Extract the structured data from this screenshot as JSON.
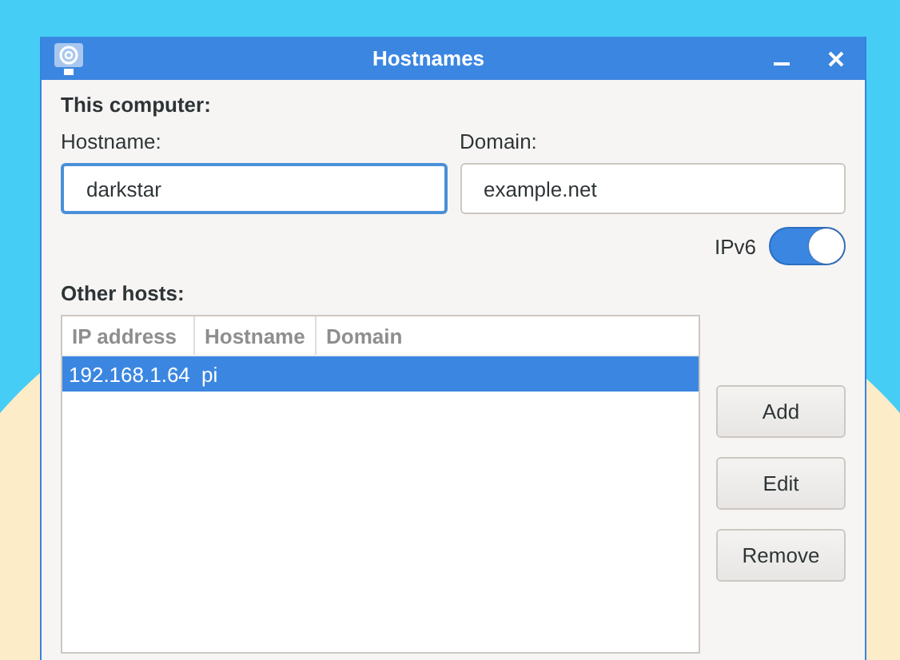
{
  "window": {
    "title": "Hostnames"
  },
  "this_computer": {
    "heading": "This computer:",
    "hostname": {
      "label": "Hostname:",
      "value": "darkstar",
      "focused": true
    },
    "domain": {
      "label": "Domain:",
      "value": "example.net",
      "focused": false
    },
    "ipv6": {
      "label": "IPv6",
      "on": true
    }
  },
  "other_hosts": {
    "heading": "Other hosts:",
    "table": {
      "columns": [
        "IP address",
        "Hostname",
        "Domain"
      ],
      "rows": [
        {
          "cells": [
            "192.168.1.64",
            "pi",
            ""
          ],
          "selected": true
        }
      ]
    }
  },
  "buttons": [
    "Add",
    "Edit",
    "Remove"
  ]
}
